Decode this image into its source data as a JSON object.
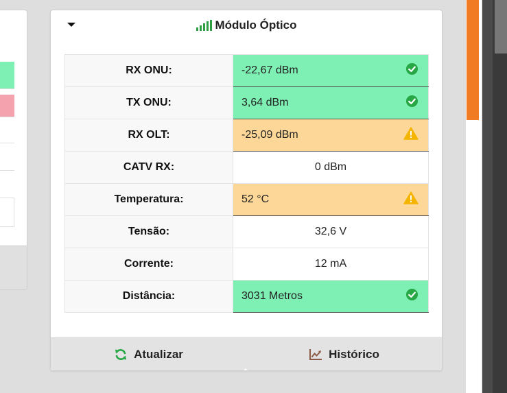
{
  "card": {
    "title": "Módulo Óptico"
  },
  "rows": [
    {
      "label": "RX ONU:",
      "value": "-22,67 dBm",
      "status": "ok"
    },
    {
      "label": "TX ONU:",
      "value": "3,64 dBm",
      "status": "ok"
    },
    {
      "label": "RX OLT:",
      "value": "-25,09 dBm",
      "status": "warn"
    },
    {
      "label": "CATV RX:",
      "value": "0 dBm",
      "status": "none"
    },
    {
      "label": "Temperatura:",
      "value": "52 °C",
      "status": "warn"
    },
    {
      "label": "Tensão:",
      "value": "32,6 V",
      "status": "none"
    },
    {
      "label": "Corrente:",
      "value": "12 mA",
      "status": "none"
    },
    {
      "label": "Distância:",
      "value": "3031 Metros",
      "status": "ok"
    }
  ],
  "footer": {
    "refresh_label": "Atualizar",
    "history_label": "Histórico"
  },
  "colors": {
    "ok": "#7ef0b4",
    "warn": "#fcd798",
    "ok_icon": "#27a745",
    "warn_icon": "#f4b400",
    "accent": "#f07b22"
  },
  "icons": {
    "title": "signal-bars-icon",
    "ok": "check-circle-icon",
    "warn": "warning-triangle-icon",
    "refresh": "refresh-icon",
    "history": "chart-line-icon",
    "collapse": "caret-down-icon"
  }
}
